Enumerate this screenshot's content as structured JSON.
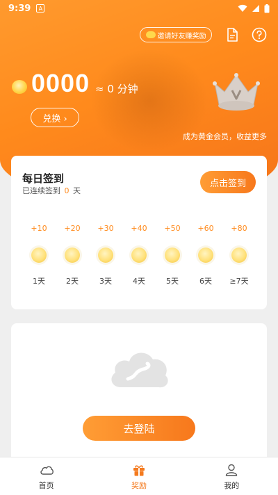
{
  "status_bar": {
    "time": "9:39",
    "app_badge": "A"
  },
  "header": {
    "invite_label": "邀请好友赚奖励"
  },
  "account": {
    "balance": "0000",
    "approx_minutes": "≈ 0 分钟",
    "exchange_label": "兑换 ›",
    "vip_promo": "成为黄金会员，收益更多"
  },
  "checkin": {
    "title": "每日签到",
    "streak_prefix": "已连续签到",
    "streak_days": "0",
    "streak_suffix": "天",
    "button_label": "点击签到",
    "days": [
      {
        "bonus": "+10",
        "label": "1天"
      },
      {
        "bonus": "+20",
        "label": "2天"
      },
      {
        "bonus": "+30",
        "label": "3天"
      },
      {
        "bonus": "+40",
        "label": "4天"
      },
      {
        "bonus": "+50",
        "label": "5天"
      },
      {
        "bonus": "+60",
        "label": "6天"
      },
      {
        "bonus": "+80",
        "label": "≥7天"
      }
    ]
  },
  "login": {
    "button_label": "去登陆"
  },
  "tabbar": {
    "tabs": [
      {
        "label": "首页",
        "icon": "cloud-icon",
        "active": false
      },
      {
        "label": "奖励",
        "icon": "gift-icon",
        "active": true
      },
      {
        "label": "我的",
        "icon": "user-icon",
        "active": false
      }
    ]
  },
  "colors": {
    "accent": "#F7781C",
    "coin": "#FFD54A",
    "background": "#EFEFEF"
  }
}
